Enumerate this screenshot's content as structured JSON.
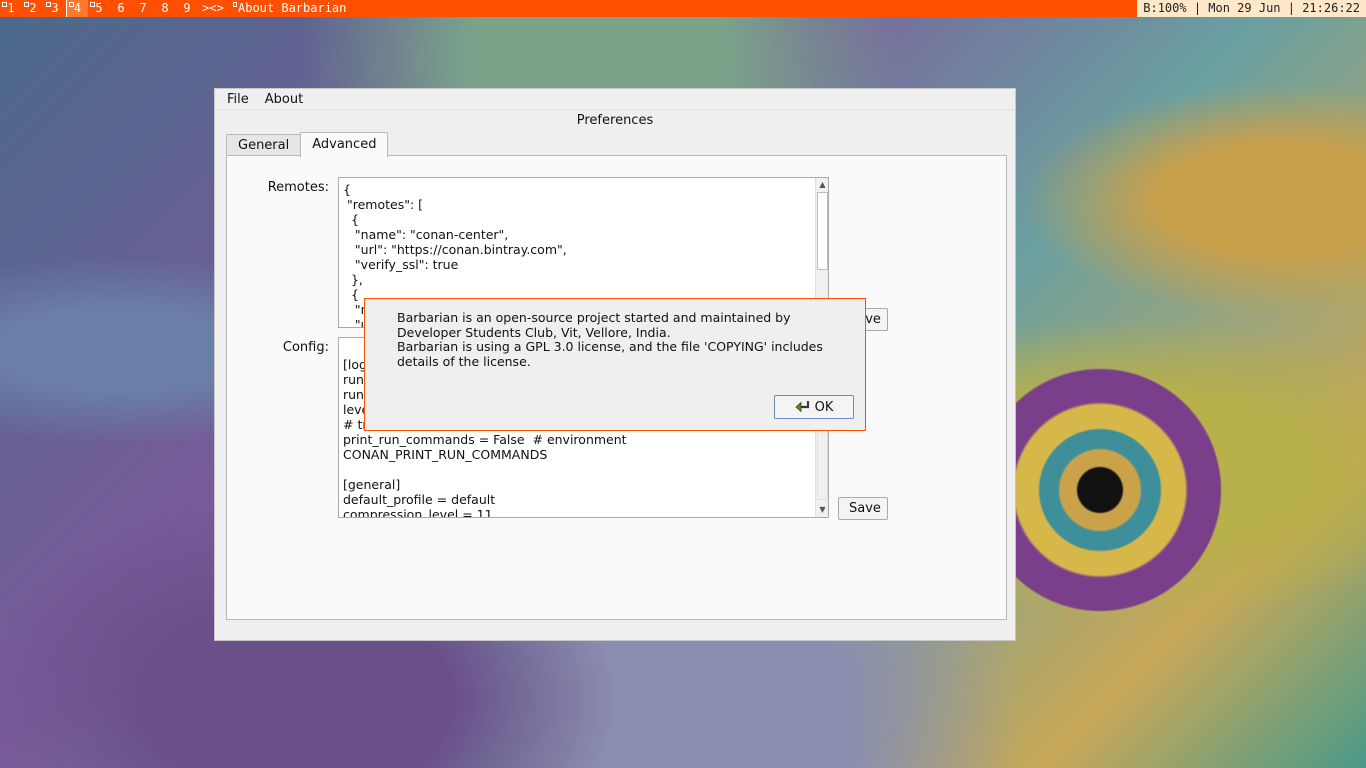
{
  "topbar": {
    "workspaces": [
      {
        "label": "1",
        "occupied": true
      },
      {
        "label": "2",
        "occupied": true
      },
      {
        "label": "3",
        "occupied": true
      },
      {
        "label": "4",
        "occupied": true,
        "active": true
      },
      {
        "label": "5",
        "occupied": true
      },
      {
        "label": "6"
      },
      {
        "label": "7"
      },
      {
        "label": "8"
      },
      {
        "label": "9"
      }
    ],
    "layout_symbol": "><>",
    "window_title": "About Barbarian",
    "status": "B:100% | Mon 29 Jun | 21:26:22"
  },
  "window": {
    "menu": [
      "File",
      "About"
    ],
    "title": "Preferences",
    "tabs": [
      {
        "label": "General",
        "active": false
      },
      {
        "label": "Advanced",
        "active": true
      }
    ],
    "remotes": {
      "label": "Remotes:",
      "text": "{\n \"remotes\": [\n  {\n   \"name\": \"conan-center\",\n   \"url\": \"https://conan.bintray.com\",\n   \"verify_ssl\": true\n  },\n  {\n   \"n\n   \"u",
      "save_label": "Save"
    },
    "config": {
      "label": "Config:",
      "text": "\n[log\nrun_\nrun_\nleve\n# tr\nprint_run_commands = False  # environment\nCONAN_PRINT_RUN_COMMANDS\n\n[general]\ndefault_profile = default\ncompression_level = 11",
      "save_label": "Save"
    }
  },
  "dialog": {
    "title": "About Barbarian",
    "message_line1": "Barbarian is an open-source project started and maintained by Developer Students Club, Vit, Vellore, India.",
    "message_line2": "Barbarian is using a GPL 3.0 license, and the file 'COPYING' includes details of the license.",
    "ok_label": "OK",
    "ok_icon": "check-arrow-icon"
  },
  "colors": {
    "accent": "#ff4f00",
    "status_bg": "#ffe7c9",
    "window_bg": "#efefef"
  }
}
